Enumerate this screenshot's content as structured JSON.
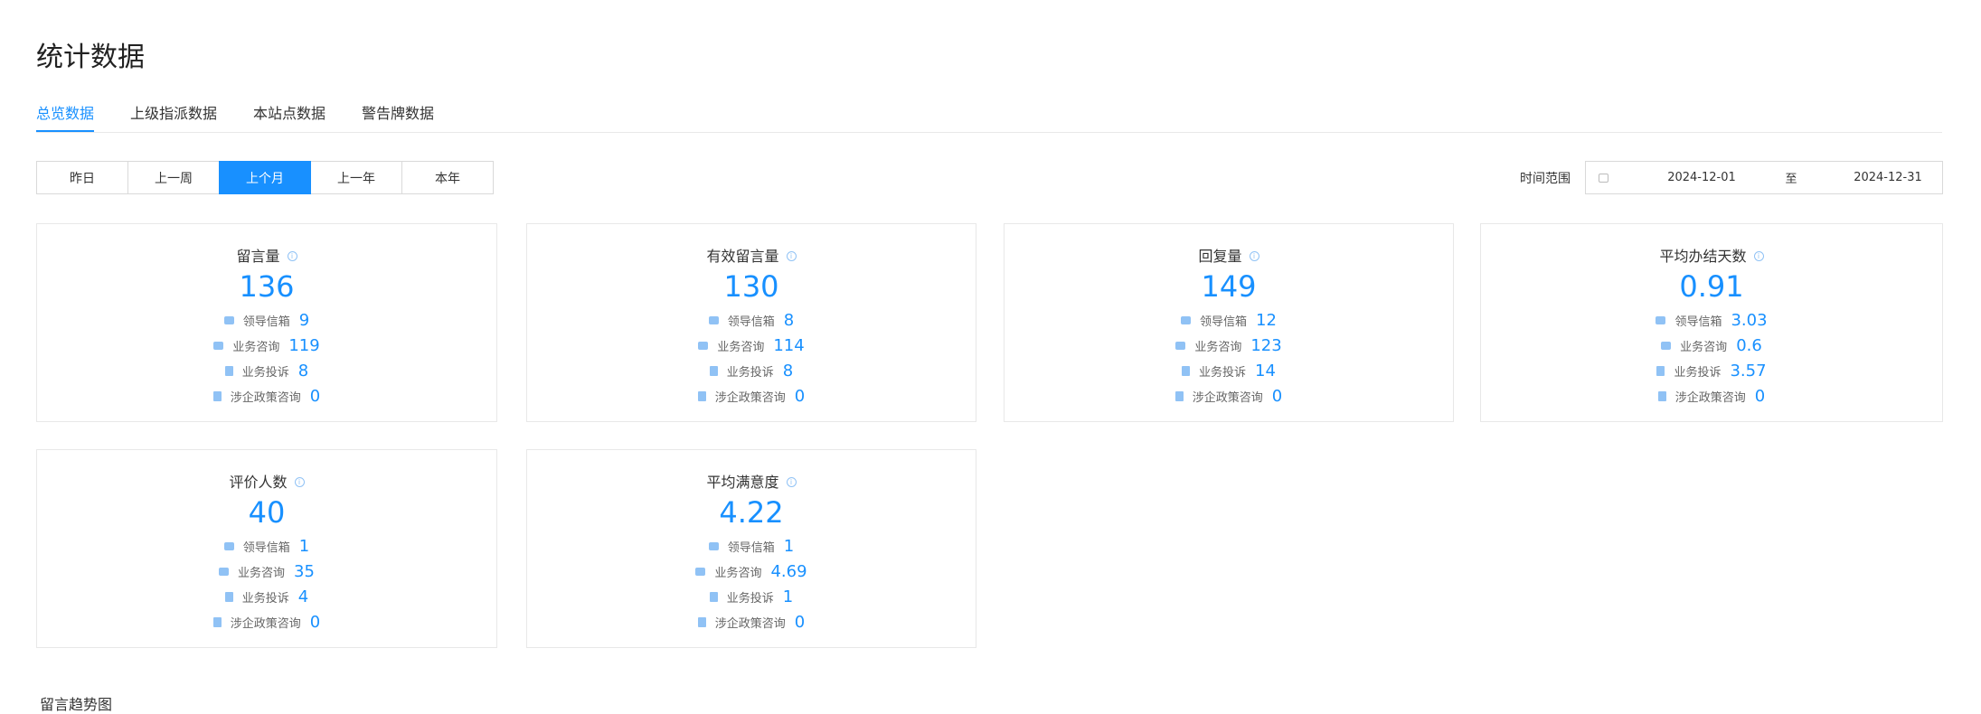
{
  "page_title": "统计数据",
  "tabs": [
    {
      "label": "总览数据",
      "active": true
    },
    {
      "label": "上级指派数据",
      "active": false
    },
    {
      "label": "本站点数据",
      "active": false
    },
    {
      "label": "警告牌数据",
      "active": false
    }
  ],
  "range_buttons": [
    {
      "label": "昨日",
      "active": false
    },
    {
      "label": "上一周",
      "active": false
    },
    {
      "label": "上个月",
      "active": true
    },
    {
      "label": "上一年",
      "active": false
    },
    {
      "label": "本年",
      "active": false
    }
  ],
  "time_range": {
    "label": "时间范围",
    "start": "2024-12-01",
    "separator": "至",
    "end": "2024-12-31"
  },
  "colors": {
    "accent": "#1890ff",
    "icon_light": "#90c2f5",
    "border": "#e8e8e8"
  },
  "cards": [
    {
      "title": "留言量",
      "value": "136",
      "items": [
        {
          "icon": "mail-icon",
          "label": "领导信箱",
          "value": "9"
        },
        {
          "icon": "chat-icon",
          "label": "业务咨询",
          "value": "119"
        },
        {
          "icon": "document-icon",
          "label": "业务投诉",
          "value": "8"
        },
        {
          "icon": "file-icon",
          "label": "涉企政策咨询",
          "value": "0"
        }
      ]
    },
    {
      "title": "有效留言量",
      "value": "130",
      "items": [
        {
          "icon": "mail-icon",
          "label": "领导信箱",
          "value": "8"
        },
        {
          "icon": "chat-icon",
          "label": "业务咨询",
          "value": "114"
        },
        {
          "icon": "document-icon",
          "label": "业务投诉",
          "value": "8"
        },
        {
          "icon": "file-icon",
          "label": "涉企政策咨询",
          "value": "0"
        }
      ]
    },
    {
      "title": "回复量",
      "value": "149",
      "items": [
        {
          "icon": "mail-icon",
          "label": "领导信箱",
          "value": "12"
        },
        {
          "icon": "chat-icon",
          "label": "业务咨询",
          "value": "123"
        },
        {
          "icon": "document-icon",
          "label": "业务投诉",
          "value": "14"
        },
        {
          "icon": "file-icon",
          "label": "涉企政策咨询",
          "value": "0"
        }
      ]
    },
    {
      "title": "平均办结天数",
      "value": "0.91",
      "items": [
        {
          "icon": "mail-icon",
          "label": "领导信箱",
          "value": "3.03"
        },
        {
          "icon": "chat-icon",
          "label": "业务咨询",
          "value": "0.6"
        },
        {
          "icon": "document-icon",
          "label": "业务投诉",
          "value": "3.57"
        },
        {
          "icon": "file-icon",
          "label": "涉企政策咨询",
          "value": "0"
        }
      ]
    },
    {
      "title": "评价人数",
      "value": "40",
      "items": [
        {
          "icon": "mail-icon",
          "label": "领导信箱",
          "value": "1"
        },
        {
          "icon": "chat-icon",
          "label": "业务咨询",
          "value": "35"
        },
        {
          "icon": "document-icon",
          "label": "业务投诉",
          "value": "4"
        },
        {
          "icon": "file-icon",
          "label": "涉企政策咨询",
          "value": "0"
        }
      ]
    },
    {
      "title": "平均满意度",
      "value": "4.22",
      "items": [
        {
          "icon": "mail-icon",
          "label": "领导信箱",
          "value": "1"
        },
        {
          "icon": "chat-icon",
          "label": "业务咨询",
          "value": "4.69"
        },
        {
          "icon": "document-icon",
          "label": "业务投诉",
          "value": "1"
        },
        {
          "icon": "file-icon",
          "label": "涉企政策咨询",
          "value": "0"
        }
      ]
    }
  ],
  "section_label": "留言趋势图"
}
